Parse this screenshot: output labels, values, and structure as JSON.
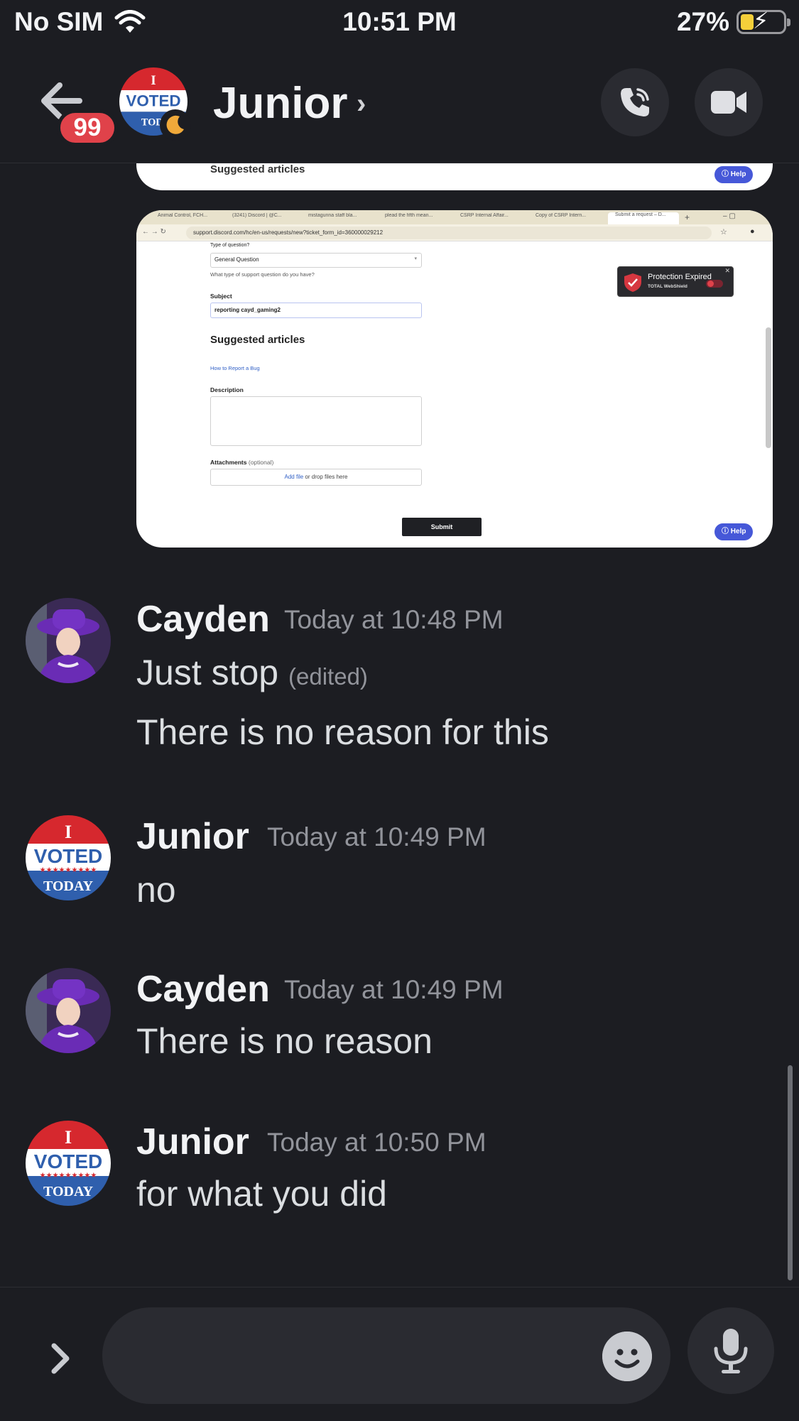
{
  "status_bar": {
    "carrier": "No SIM",
    "time": "10:51 PM",
    "battery": "27%"
  },
  "header": {
    "title": "Junior",
    "unread_count": "99"
  },
  "screenshot_top": {
    "suggested": "Suggested articles",
    "help": "Help"
  },
  "screenshot": {
    "tabs": [
      "Animal Control, FCH...",
      "(3241) Discord | @C...",
      "mistagunna staff bla...",
      "plead the fifth mean...",
      "CSRP Internal Affair...",
      "Copy of CSRP Intern...",
      "Submit a request – D..."
    ],
    "url": "support.discord.com/hc/en-us/requests/new?ticket_form_id=360000029212",
    "type_label": "Type of question?",
    "type_value": "General Question",
    "type_hint": "What type of support question do you have?",
    "subject_label": "Subject",
    "subject_value": "reporting cayd_gaming2",
    "suggested": "Suggested articles",
    "article_link": "How to Report a Bug",
    "description_label": "Description",
    "attachments_label": "Attachments",
    "attachments_optional": "(optional)",
    "add_file": "Add file",
    "drop_files": " or drop files here",
    "submit": "Submit",
    "help": "Help",
    "protection_title": "Protection Expired",
    "protection_brand": "TOTAL WebShield"
  },
  "messages": [
    {
      "author": "Cayden",
      "time": "Today at 10:48 PM",
      "lines": [
        "Just stop",
        "There is no reason for this"
      ],
      "edited": "(edited)"
    },
    {
      "author": "Junior",
      "time": "Today at 10:49 PM",
      "lines": [
        "no"
      ]
    },
    {
      "author": "Cayden",
      "time": "Today at 10:49 PM",
      "lines": [
        "There is no reason"
      ]
    },
    {
      "author": "Junior",
      "time": "Today at 10:50 PM",
      "lines": [
        "for what you did"
      ]
    }
  ],
  "avatar_voted": {
    "top": "I",
    "mid": "VOTED",
    "bottom": "TODAY"
  },
  "composer": {
    "placeholder": ""
  },
  "icons": {
    "back": "arrow-left-icon",
    "moon": "moon-icon",
    "call": "phone-icon",
    "video": "video-camera-icon",
    "wifi": "wifi-icon",
    "battery": "battery-charging-icon",
    "expand": "chevron-right-icon",
    "emoji": "emoji-icon",
    "mic": "microphone-icon"
  },
  "colors": {
    "background": "#1c1d22",
    "badge": "#e0424a",
    "battery_fill": "#f4cf3a",
    "help_button": "#4658d8"
  }
}
